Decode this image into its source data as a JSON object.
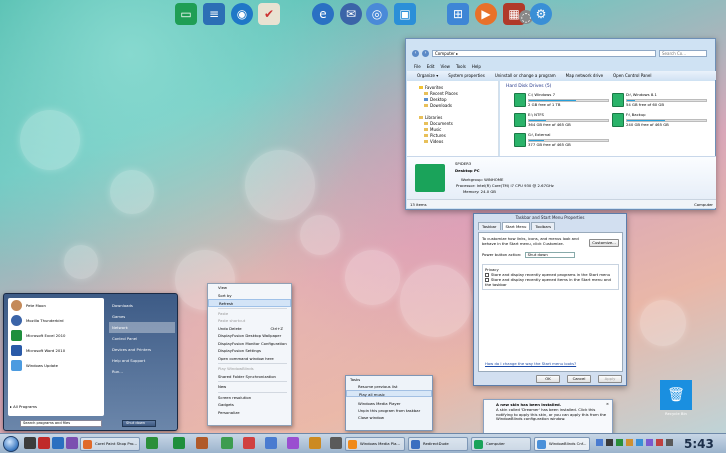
{
  "colors": {
    "accent": "#3b78c0",
    "drive_bar": "#26a0da",
    "pc_icon": "#1aa35a"
  },
  "dock": {
    "icons": [
      "monitor-icon",
      "document-icon",
      "globe-icon",
      "checklist-icon",
      "ie-globe-icon",
      "thunderbird-icon",
      "chrome-icon",
      "display-icon",
      "windows-logo-icon",
      "media-center-icon",
      "firewall-icon",
      "dvd-icon",
      "gear-icon"
    ]
  },
  "explorer": {
    "address": "Computer ▸",
    "search_placeholder": "Search Co...",
    "menu": [
      "File",
      "Edit",
      "View",
      "Tools",
      "Help"
    ],
    "toolbar": [
      "Organize ▾",
      "System properties",
      "Uninstall or change a program",
      "Map network drive",
      "Open Control Panel"
    ],
    "nav": {
      "favorites": "Favorites",
      "favorites_items": [
        "Recent Places",
        "Desktop",
        "Downloads"
      ],
      "libraries": "Libraries",
      "libraries_items": [
        "Documents",
        "Music",
        "Pictures",
        "Videos"
      ]
    },
    "hdd_title": "Hard Disk Drives (5)",
    "drives": [
      {
        "name": "C:\\ Windows 7",
        "free": "2 GB free of 1 TB",
        "fill": 0.6
      },
      {
        "name": "D:\\ Windows 8.1",
        "free": "54 GB free of 60 GB",
        "fill": 0.1
      },
      {
        "name": "E:\\ NTFS",
        "free": "364 GB free of 465 GB",
        "fill": 0.22
      },
      {
        "name": "F:\\ Backup",
        "free": "240 GB free of 465 GB",
        "fill": 0.48
      },
      {
        "name": "G:\\ External",
        "free": "377 GB free of 465 GB",
        "fill": 0.19
      }
    ],
    "details": {
      "pc_name": "SPIDER3",
      "pc_type": "Desktop PC",
      "workgroup_label": "Workgroup:",
      "workgroup": "WINHOME",
      "processor_label": "Processor:",
      "processor": "Intel(R) Core(TM) i7 CPU   930 @ 2.67GHz",
      "memory_label": "Memory:",
      "memory": "24.0 GB"
    },
    "status_left": "13 items",
    "status_right": "Computer"
  },
  "props": {
    "title": "Taskbar and Start Menu Properties",
    "tabs": [
      "Taskbar",
      "Start Menu",
      "Toolbars"
    ],
    "intro": "To customize how links, icons, and menus look and behave in the Start menu, click Customize.",
    "customize": "Customize...",
    "power_label": "Power button action:",
    "power_value": "Shut down",
    "privacy": "Privacy",
    "opt1": "Store and display recently opened programs in the Start menu",
    "opt2": "Store and display recently opened items in the Start menu and the taskbar",
    "link": "How do I change the way the Start menu looks?",
    "ok": "OK",
    "cancel": "Cancel",
    "apply": "Apply"
  },
  "startmenu": {
    "programs": [
      "Pete Moon",
      "Mozilla Thunderbird",
      "Microsoft Excel 2010",
      "Microsoft Word 2010",
      "Windows Update"
    ],
    "all_programs": "All Programs",
    "search_placeholder": "Search programs and files",
    "shutdown": "Shut down",
    "right": [
      "Downloads",
      "Games",
      "Network",
      "Control Panel",
      "Devices and Printers",
      "Help and Support",
      "Run..."
    ]
  },
  "ctx": {
    "items": [
      "View",
      "Sort by",
      "Refresh",
      "Paste",
      "Paste shortcut",
      "Undo Delete",
      "DisplayFusion Desktop Wallpaper",
      "DisplayFusion Monitor Configuration",
      "DisplayFusion Settings",
      "Open command window here",
      "Play WindowBlinds",
      "Shared Folder Synchronization",
      "New",
      "Screen resolution",
      "Gadgets",
      "Personalize"
    ],
    "undo_shortcut": "Ctrl+Z"
  },
  "jump": {
    "header": "Tasks",
    "items": [
      "Resume previous list",
      "Play all music",
      "Windows Media Player",
      "Unpin this program from taskbar",
      "Close window"
    ]
  },
  "notif": {
    "title": "A new skin has been installed.",
    "body": "A skin called 'Dreamer' has been installed. Click this notifying to apply this skin, or you can apply this from the WindowBlinds configuration window."
  },
  "recycle": {
    "label": "Recycle Bin"
  },
  "taskbar": {
    "tasks": [
      "Corel Paint Shop Pro...",
      "Windows Media Pla...",
      "RedirectDude",
      "Computer",
      "WindowBlinds Cnf..."
    ],
    "clock": "5:43"
  }
}
